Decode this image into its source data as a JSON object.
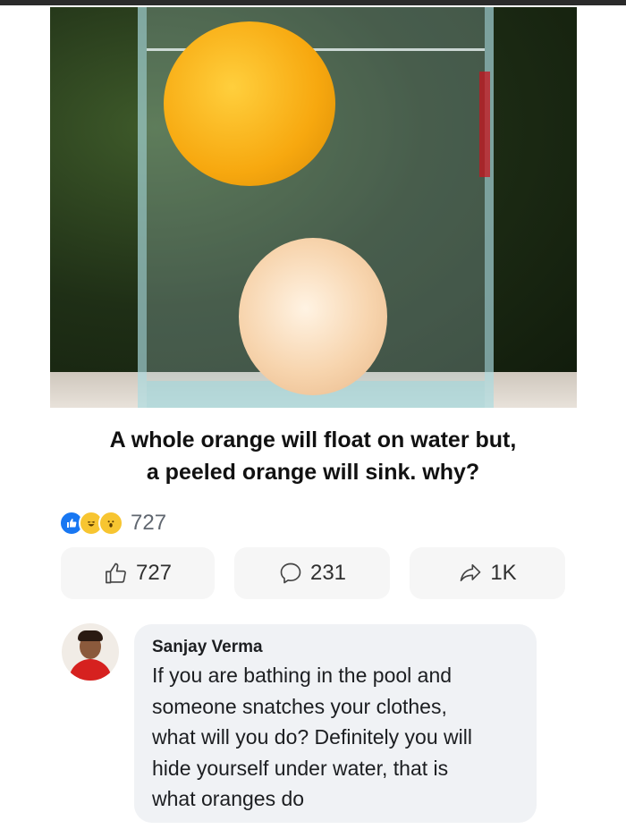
{
  "post": {
    "image_alt": "whole orange floating and peeled orange sunk in glass of water",
    "caption_lines": [
      "A whole orange will float on water but,",
      "a peeled orange will sink. why?"
    ]
  },
  "reactions": {
    "icons": [
      "like-icon",
      "haha-icon",
      "wow-icon"
    ],
    "count": "727"
  },
  "actions": {
    "like_count": "727",
    "comment_count": "231",
    "share_count": "1K"
  },
  "comment": {
    "author": "Sanjay Verma",
    "text_lines": [
      "If you are bathing in the pool and",
      "someone snatches your clothes,",
      "what will you do? Definitely you will",
      "hide yourself under water, that is",
      "what oranges do"
    ]
  },
  "colors": {
    "like_blue": "#1877f2",
    "bubble_bg": "#f0f2f5",
    "button_bg": "#f6f6f6"
  }
}
